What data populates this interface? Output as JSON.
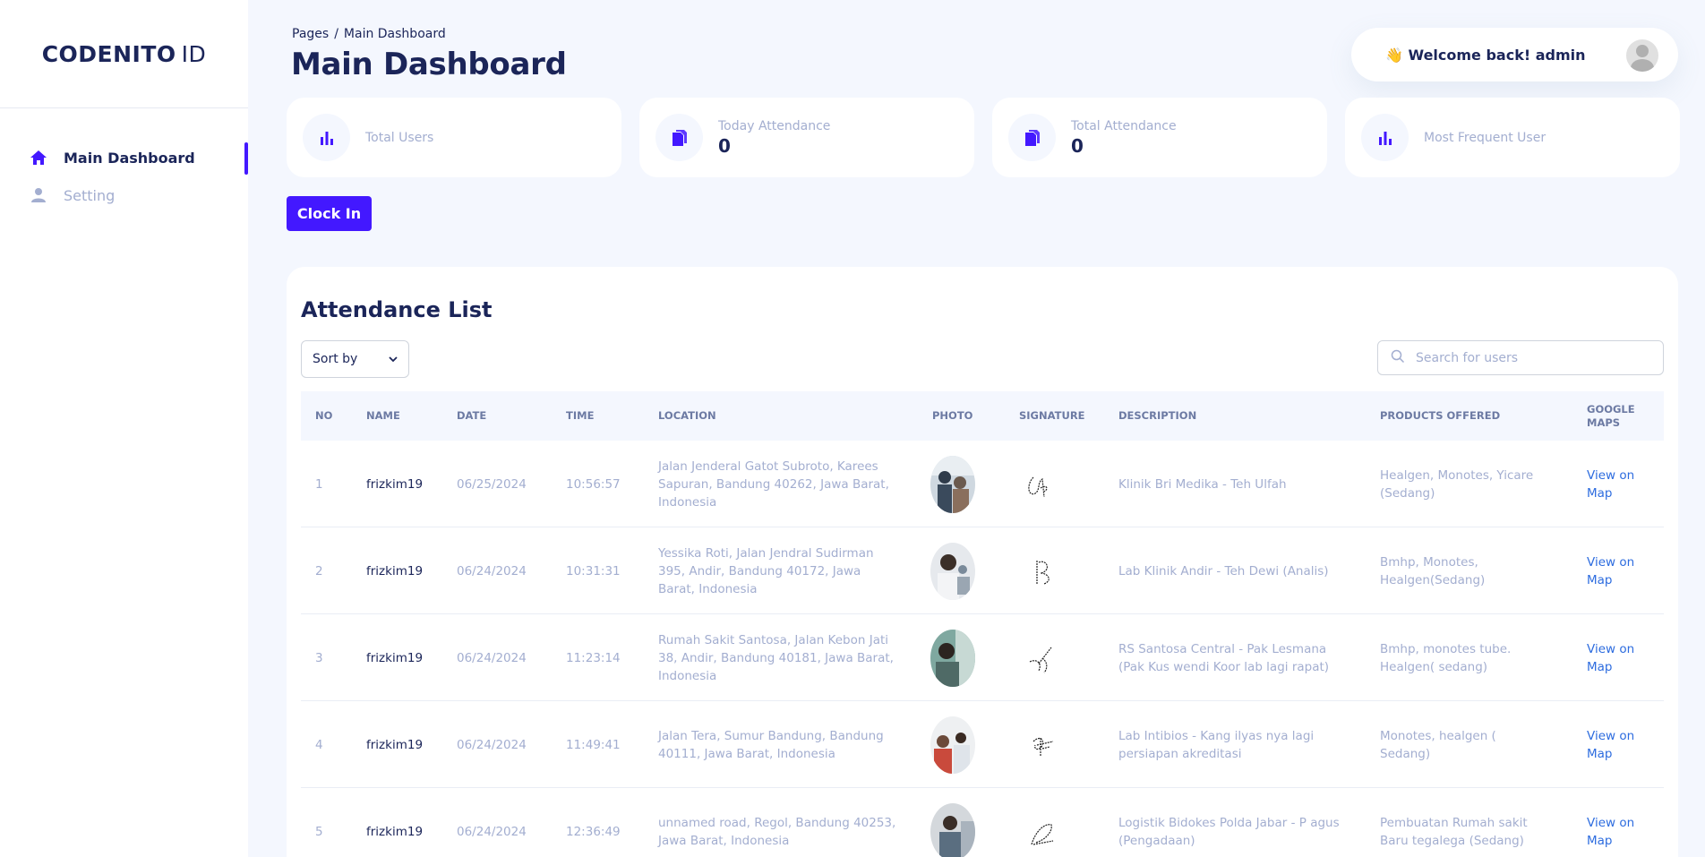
{
  "brand": {
    "bold": "CODENITO",
    "thin": "ID"
  },
  "sidebar": {
    "items": [
      {
        "label": "Main Dashboard",
        "icon": "home-icon",
        "active": true
      },
      {
        "label": "Setting",
        "icon": "user-icon",
        "active": false
      }
    ]
  },
  "breadcrumb": {
    "root": "Pages",
    "sep": "/",
    "current": "Main Dashboard"
  },
  "header": {
    "title": "Main Dashboard",
    "welcome": "👋 Welcome back! admin"
  },
  "stats": [
    {
      "label": "Total Users",
      "value": "",
      "icon": "bar-chart-icon"
    },
    {
      "label": "Today Attendance",
      "value": "0",
      "icon": "documents-icon"
    },
    {
      "label": "Total Attendance",
      "value": "0",
      "icon": "documents-icon"
    },
    {
      "label": "Most Frequent User",
      "value": "",
      "icon": "bar-chart-icon"
    }
  ],
  "clock_in_label": "Clock In",
  "attendance": {
    "title": "Attendance List",
    "sort_label": "Sort by",
    "search_placeholder": "Search for users",
    "columns": [
      "NO",
      "NAME",
      "DATE",
      "TIME",
      "LOCATION",
      "PHOTO",
      "SIGNATURE",
      "DESCRIPTION",
      "PRODUCTS OFFERED",
      "GOOGLE MAPS"
    ],
    "rows": [
      {
        "no": "1",
        "name": "frizkim19",
        "date": "06/25/2024",
        "time": "10:56:57",
        "location": "Jalan Jenderal Gatot Subroto, Karees Sapuran, Bandung 40262, Jawa Barat, Indonesia",
        "description": "Klinik Bri Medika - Teh Ulfah",
        "products": "Healgen, Monotes, Yicare (Sedang)",
        "map": "View on Map"
      },
      {
        "no": "2",
        "name": "frizkim19",
        "date": "06/24/2024",
        "time": "10:31:31",
        "location": "Yessika Roti, Jalan Jendral Sudirman 395, Andir, Bandung 40172, Jawa Barat, Indonesia",
        "description": "Lab Klinik Andir - Teh Dewi (Analis)",
        "products": "Bmhp, Monotes, Healgen(Sedang)",
        "map": "View on Map"
      },
      {
        "no": "3",
        "name": "frizkim19",
        "date": "06/24/2024",
        "time": "11:23:14",
        "location": "Rumah Sakit Santosa, Jalan Kebon Jati 38, Andir, Bandung 40181, Jawa Barat, Indonesia",
        "description": "RS Santosa Central - Pak Lesmana (Pak Kus wendi Koor lab lagi rapat)",
        "products": "Bmhp, monotes tube. Healgen( sedang)",
        "map": "View on Map"
      },
      {
        "no": "4",
        "name": "frizkim19",
        "date": "06/24/2024",
        "time": "11:49:41",
        "location": "Jalan Tera, Sumur Bandung, Bandung 40111, Jawa Barat, Indonesia",
        "description": "Lab Intibios - Kang ilyas nya lagi persiapan akreditasi",
        "products": "Monotes, healgen ( Sedang)",
        "map": "View on Map"
      },
      {
        "no": "5",
        "name": "frizkim19",
        "date": "06/24/2024",
        "time": "12:36:49",
        "location": "unnamed road, Regol, Bandung 40253, Jawa Barat, Indonesia",
        "description": "Logistik Bidokes Polda Jabar - P agus (Pengadaan)",
        "products": "Pembuatan Rumah sakit Baru tegalega (Sedang)",
        "map": "View on Map"
      }
    ]
  },
  "colors": {
    "accent": "#4318ff",
    "text": "#1b2559",
    "muted": "#a3aed0",
    "background": "#f4f7fe",
    "link": "#2d6cdf"
  }
}
